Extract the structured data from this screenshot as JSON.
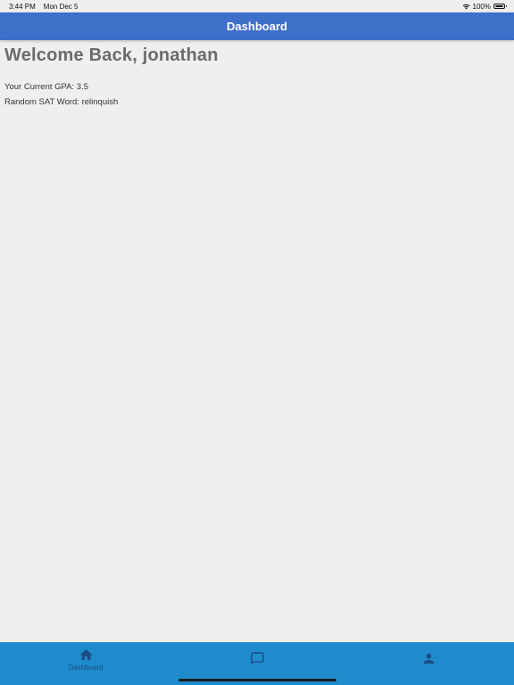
{
  "status_bar": {
    "time": "3:44 PM",
    "date": "Mon Dec 5",
    "battery_text": "100%",
    "battery_level": 1.0,
    "icons": [
      "wifi-icon",
      "battery-icon"
    ]
  },
  "app_bar": {
    "title": "Dashboard",
    "color": "#3f70c9"
  },
  "main": {
    "welcome": "Welcome Back, jonathan",
    "gpa_line": "Your Current GPA: 3.5",
    "sat_line": "Random SAT Word: relinquish"
  },
  "bottom_nav": {
    "color": "#1e8bcc",
    "active_color": "#1c4d86",
    "items": [
      {
        "icon": "home-icon",
        "label": "Dashboard",
        "active": true
      },
      {
        "icon": "chat-icon",
        "label": "",
        "active": false
      },
      {
        "icon": "person-icon",
        "label": "",
        "active": false
      }
    ]
  }
}
